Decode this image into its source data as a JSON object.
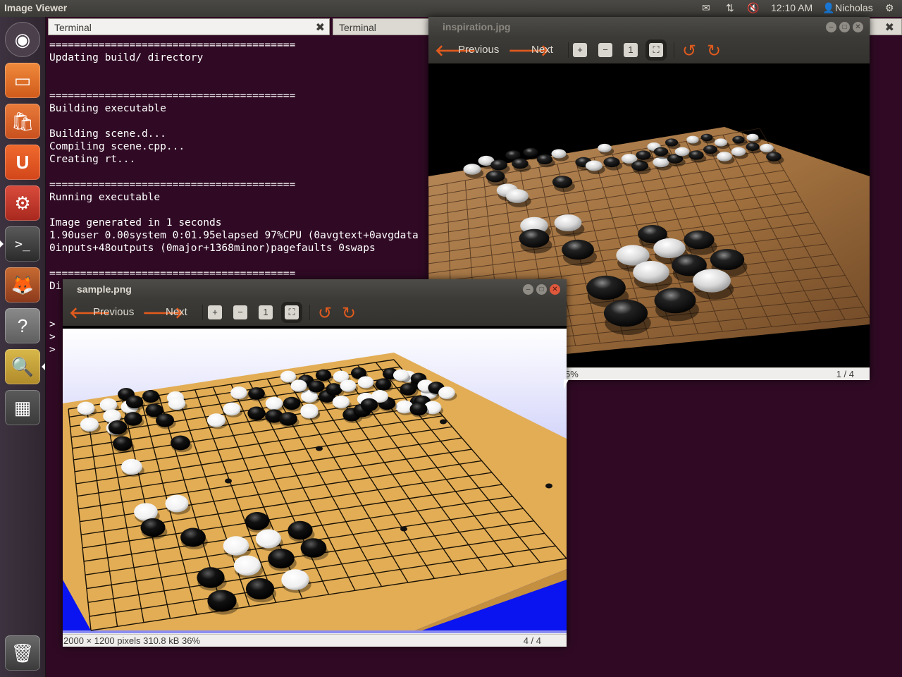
{
  "panel": {
    "app_title": "Image Viewer",
    "clock": "12:10 AM",
    "user": "Nicholas",
    "icons": [
      "mail-icon",
      "network-icon",
      "volume-muted-icon",
      "user-icon",
      "power-icon"
    ]
  },
  "launcher": {
    "items": [
      "dash-home",
      "files",
      "ubuntu-software-center",
      "ubuntu-one",
      "system-settings",
      "terminal",
      "firefox",
      "help",
      "image-viewer",
      "workspace-switcher",
      "trash"
    ]
  },
  "terminal": {
    "tabs": [
      "Terminal",
      "Terminal"
    ],
    "lines": [
      "========================================",
      "Updating build/ directory",
      "",
      "",
      "========================================",
      "Building executable",
      "",
      "Building scene.d...",
      "Compiling scene.cpp...",
      "Creating rt...",
      "",
      "========================================",
      "Running executable",
      "",
      "Image generated in 1 seconds",
      "1.90user 0.00system 0:01.95elapsed 97%CPU (0avgtext+0avgdata",
      "0inputs+48outputs (0major+1368minor)pagefaults 0swaps",
      "",
      "========================================",
      "Di",
      "",
      "",
      ">",
      ">",
      ">"
    ]
  },
  "viewer_back": {
    "title": "inspiration.jpg",
    "previous_label": "Previous",
    "next_label": "Next",
    "status_left": "5%",
    "status_right": "1 / 4"
  },
  "viewer_front": {
    "title": "sample.png",
    "previous_label": "Previous",
    "next_label": "Next",
    "status_left": "2000 × 1200 pixels  310.8 kB   36%",
    "status_right": "4 / 4"
  },
  "colors": {
    "terminal_bg": "#300a24",
    "accent_orange": "#e05a1e",
    "board_wood": "#e2ad55",
    "panel_bg": "#3c3b37"
  }
}
